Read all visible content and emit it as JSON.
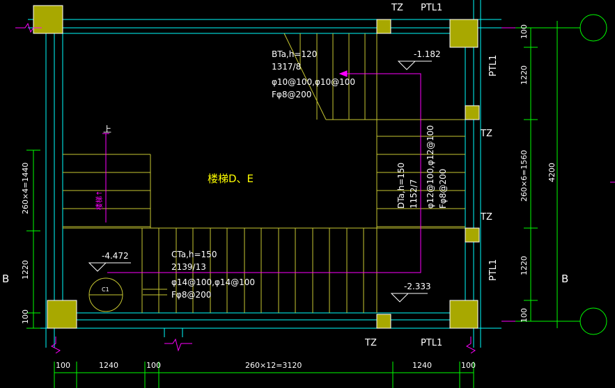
{
  "labels": {
    "tz_top": "TZ",
    "ptl1_top": "PTL1",
    "tz_right_upper": "TZ",
    "tz_right_lower": "TZ",
    "ptl1_right_upper": "PTL1",
    "ptl1_right_lower": "PTL1",
    "tz_bottom": "TZ",
    "ptl1_bottom": "PTL1",
    "stair_title": "楼梯D、E",
    "up_arrow_text": "上",
    "stair_label_vertical": "楼梯↑",
    "grid_b_left": "B",
    "grid_b_right": "B",
    "slab_marker": "C1"
  },
  "stair_bt": {
    "name": "BTa,h=120",
    "dims": "1317/8",
    "rebar": "φ10@100,φ10@100",
    "dist": "Fφ8@200"
  },
  "stair_ct": {
    "name": "CTa,h=150",
    "dims": "2139/13",
    "rebar": "φ14@100,φ14@100",
    "dist": "Fφ8@200"
  },
  "stair_dt": {
    "name": "DTa,h=150",
    "dims": "1152/7",
    "rebar": "φ12@100,φ12@100",
    "dist": "Fφ8@200"
  },
  "elevations": {
    "upper_right": "-1.182",
    "left": "-4.472",
    "lower_right": "-2.333"
  },
  "dims_bottom": [
    "100",
    "1240",
    "100",
    "260×12=3120",
    "1240",
    "100"
  ],
  "dims_left": [
    "260×4=1440",
    "1220",
    "100"
  ],
  "dims_right": [
    "100",
    "1220",
    "260×6=1560",
    "1220",
    "100"
  ],
  "dims_right_total": "4200",
  "colors": {
    "background": "#000000",
    "wall": "#00ffff",
    "stair": "#c8c832",
    "column": "#a8a800",
    "dim": "#00ff00",
    "magenta": "#ff00ff",
    "white": "#ffffff",
    "yellow": "#ffff00"
  }
}
